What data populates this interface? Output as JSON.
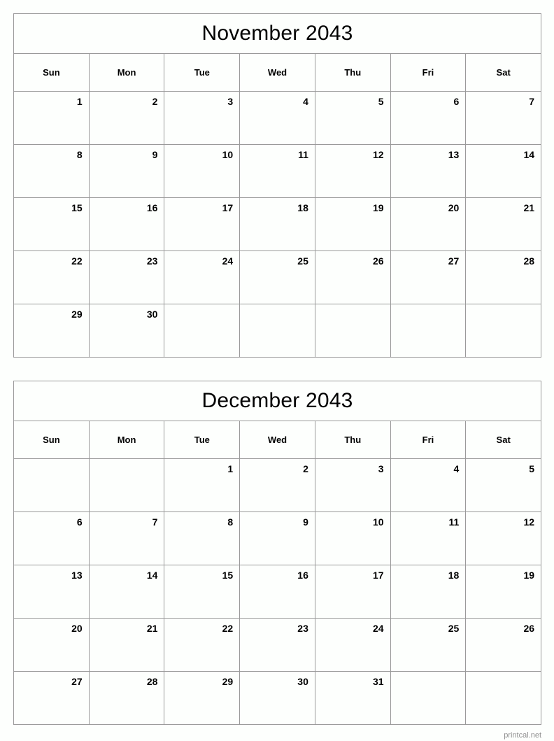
{
  "footer": {
    "text": "printcal.net"
  },
  "weekdays": [
    "Sun",
    "Mon",
    "Tue",
    "Wed",
    "Thu",
    "Fri",
    "Sat"
  ],
  "colors": {
    "border": "#9a9a9a",
    "background": "#fdfffd",
    "text": "#000000",
    "footer_text": "#8f8f8f"
  },
  "months": [
    {
      "title": "November 2043",
      "year": 2043,
      "month_name": "November",
      "first_weekday": "Sun",
      "days_in_month": 30,
      "weeks": [
        [
          "1",
          "2",
          "3",
          "4",
          "5",
          "6",
          "7"
        ],
        [
          "8",
          "9",
          "10",
          "11",
          "12",
          "13",
          "14"
        ],
        [
          "15",
          "16",
          "17",
          "18",
          "19",
          "20",
          "21"
        ],
        [
          "22",
          "23",
          "24",
          "25",
          "26",
          "27",
          "28"
        ],
        [
          "29",
          "30",
          "",
          "",
          "",
          "",
          ""
        ]
      ]
    },
    {
      "title": "December 2043",
      "year": 2043,
      "month_name": "December",
      "first_weekday": "Tue",
      "days_in_month": 31,
      "weeks": [
        [
          "",
          "",
          "1",
          "2",
          "3",
          "4",
          "5"
        ],
        [
          "6",
          "7",
          "8",
          "9",
          "10",
          "11",
          "12"
        ],
        [
          "13",
          "14",
          "15",
          "16",
          "17",
          "18",
          "19"
        ],
        [
          "20",
          "21",
          "22",
          "23",
          "24",
          "25",
          "26"
        ],
        [
          "27",
          "28",
          "29",
          "30",
          "31",
          "",
          ""
        ]
      ]
    }
  ]
}
